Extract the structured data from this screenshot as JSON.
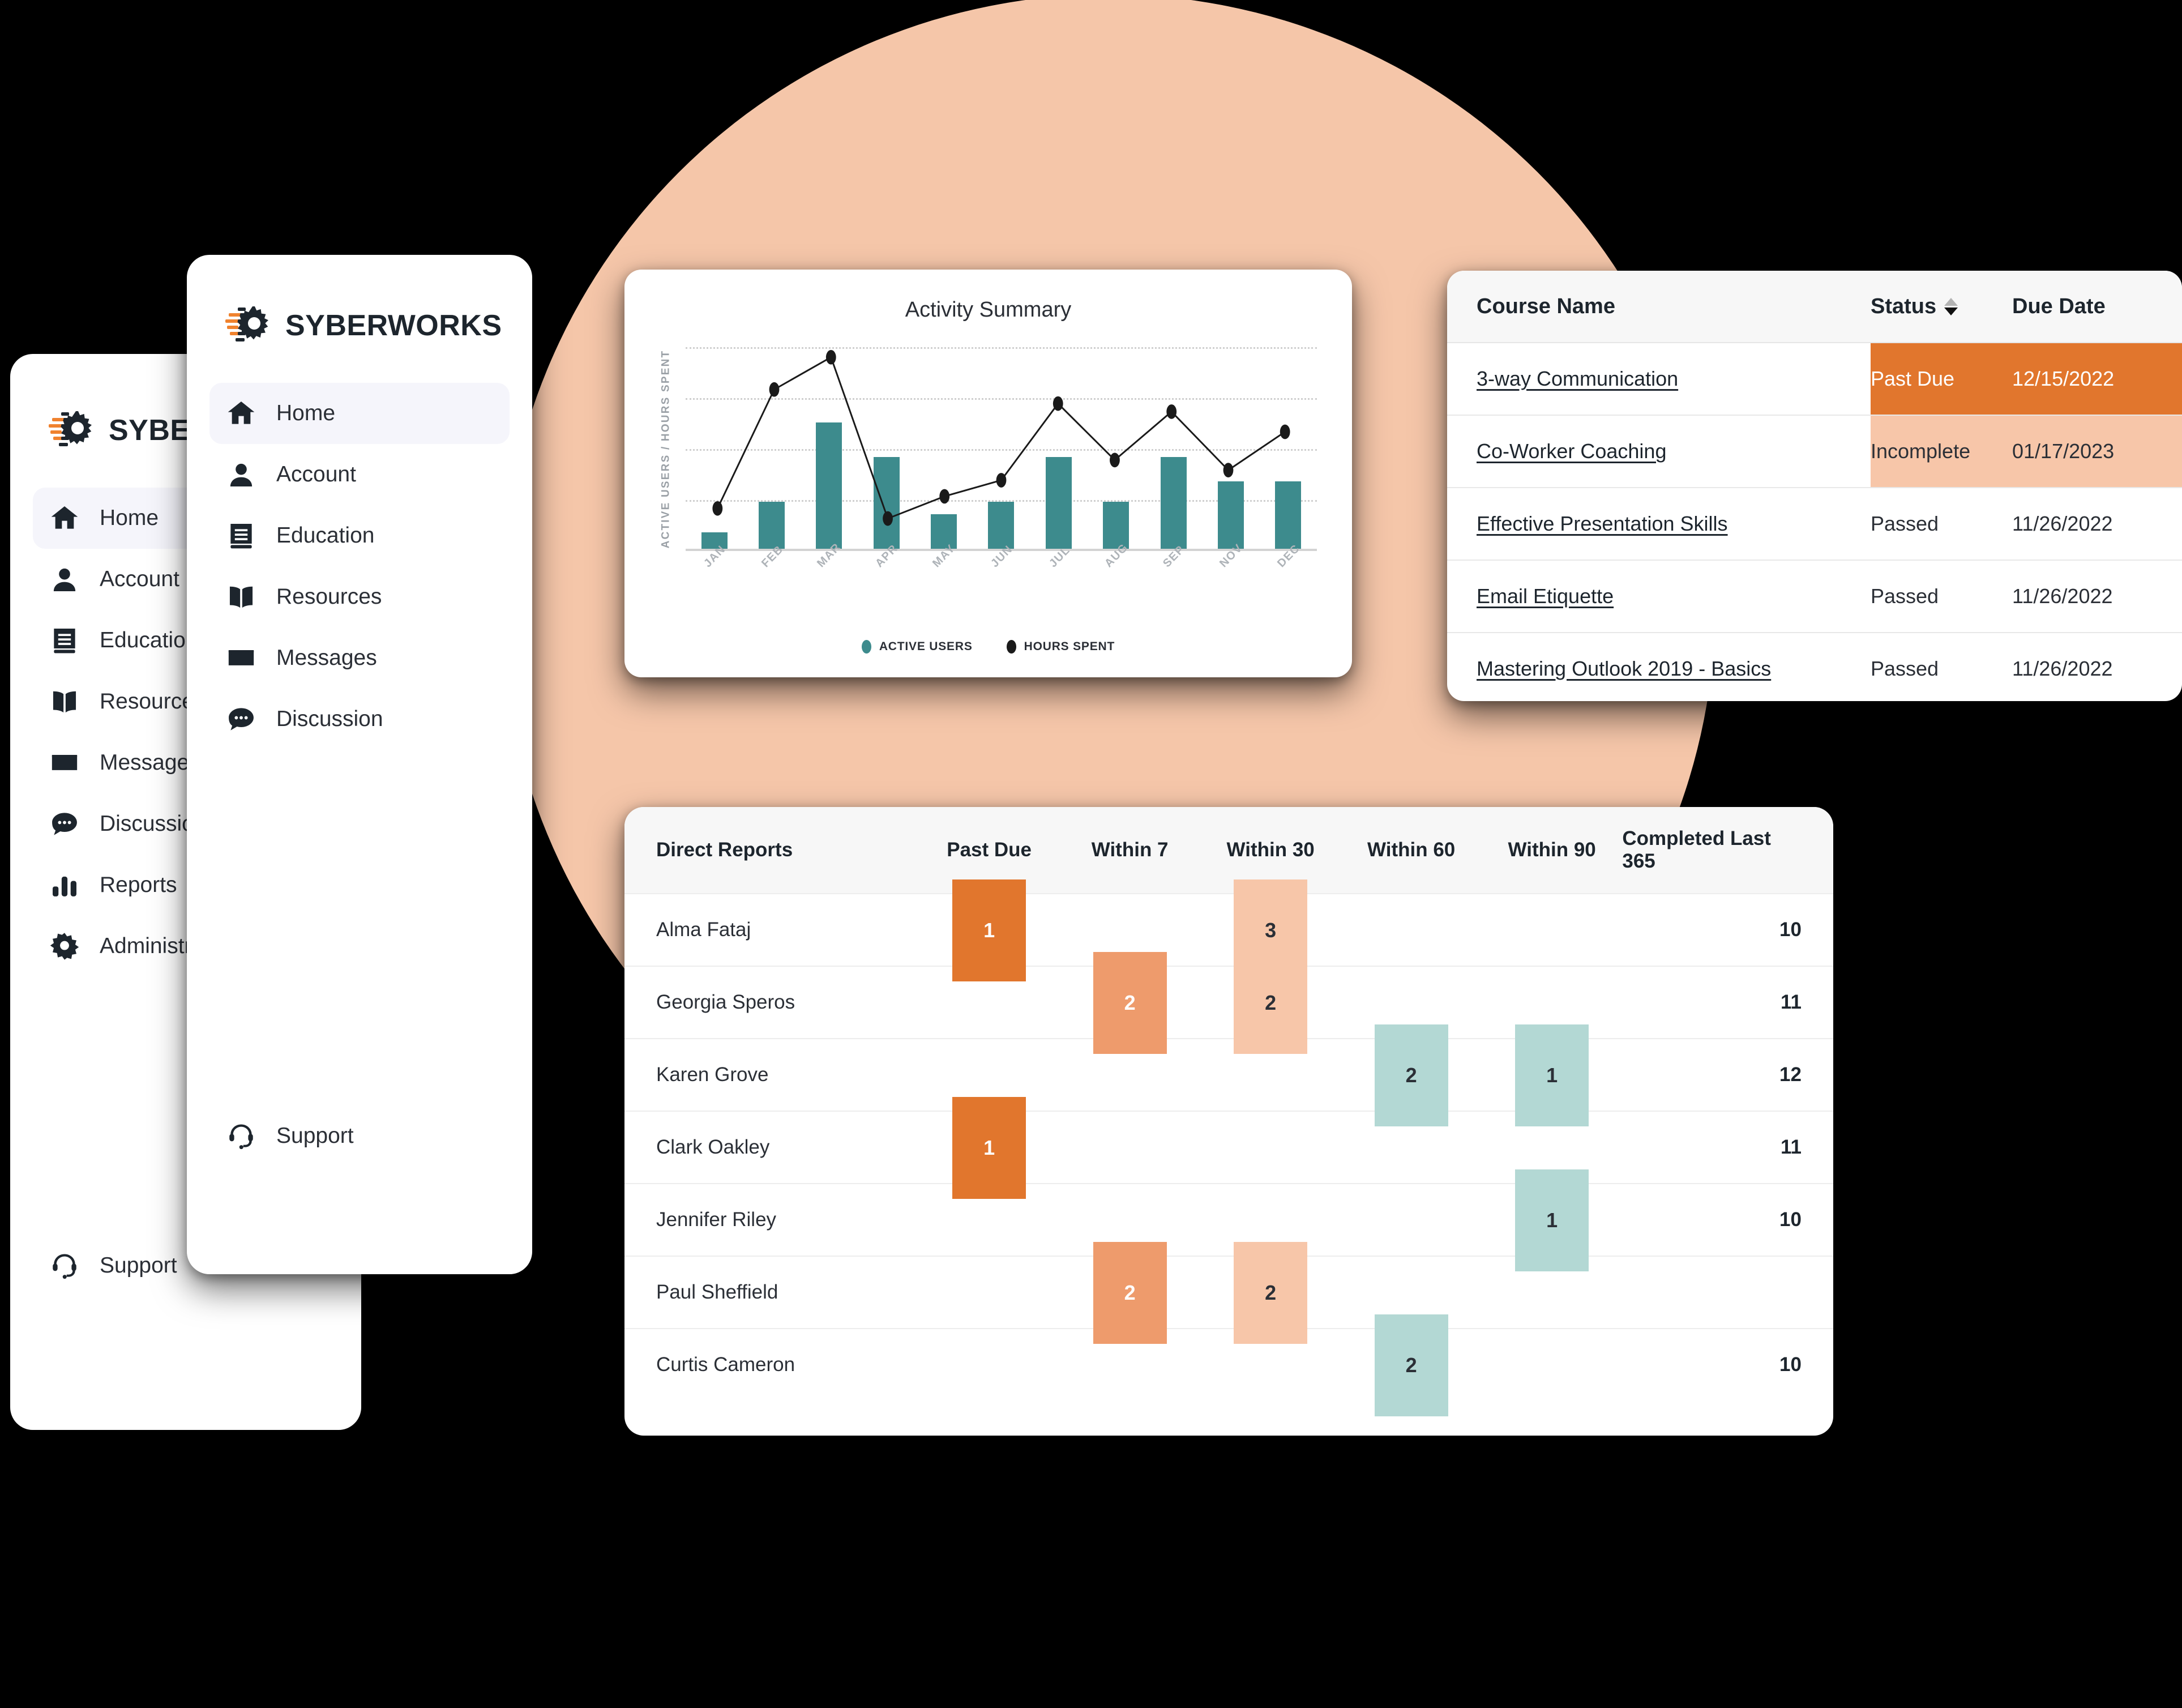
{
  "brand": {
    "name": "SYBERWORKS"
  },
  "sidebar_front": {
    "items": [
      {
        "label": "Home",
        "icon": "home-icon",
        "active": true
      },
      {
        "label": "Account",
        "icon": "user-icon",
        "active": false
      },
      {
        "label": "Education",
        "icon": "book-icon",
        "active": false
      },
      {
        "label": "Resources",
        "icon": "open-book-icon",
        "active": false
      },
      {
        "label": "Messages",
        "icon": "envelope-icon",
        "active": false
      },
      {
        "label": "Discussion",
        "icon": "chat-bubble-icon",
        "active": false
      }
    ],
    "support": {
      "label": "Support",
      "icon": "headset-icon"
    }
  },
  "sidebar_back": {
    "items": [
      {
        "label": "Home",
        "icon": "home-icon",
        "active": true
      },
      {
        "label": "Account",
        "icon": "user-icon",
        "active": false
      },
      {
        "label": "Education",
        "icon": "book-icon",
        "active": false
      },
      {
        "label": "Resources",
        "icon": "open-book-icon",
        "active": false
      },
      {
        "label": "Messages",
        "icon": "envelope-icon",
        "active": false
      },
      {
        "label": "Discussion",
        "icon": "chat-bubble-icon",
        "active": false
      },
      {
        "label": "Reports",
        "icon": "bar-chart-icon",
        "active": false
      },
      {
        "label": "Administration",
        "icon": "gear-icon",
        "active": false
      }
    ],
    "support": {
      "label": "Support",
      "icon": "headset-icon"
    }
  },
  "chart_data": {
    "type": "bar",
    "title": "Activity Summary",
    "xlabel": "",
    "ylabel": "ACTIVE USERS / HOURS SPENT",
    "categories": [
      "JAN",
      "FEB",
      "MAR",
      "APR",
      "MAY",
      "JUN",
      "JUL",
      "AUG",
      "SEP",
      "NOV",
      "DEC"
    ],
    "ylim": [
      0,
      100
    ],
    "grid": true,
    "gridlines": [
      25,
      50,
      75,
      100
    ],
    "legend_position": "bottom",
    "series": [
      {
        "name": "ACTIVE USERS",
        "type": "bar",
        "color": "#3d8b8d",
        "values": [
          8,
          23,
          62,
          45,
          17,
          23,
          45,
          23,
          45,
          33,
          33
        ]
      },
      {
        "name": "HOURS SPENT",
        "type": "line",
        "color": "#1a1a1a",
        "values": [
          20,
          79,
          95,
          15,
          26,
          34,
          72,
          44,
          68,
          39,
          58
        ]
      }
    ]
  },
  "course_table": {
    "columns": [
      "Course Name",
      "Status",
      "Due Date"
    ],
    "sort_column": "Status",
    "rows": [
      {
        "name": "3-way Communication",
        "status": "Past Due",
        "due": "12/15/2022",
        "highlight": "pastdue"
      },
      {
        "name": "Co-Worker Coaching",
        "status": "Incomplete",
        "due": "01/17/2023",
        "highlight": "incomplete"
      },
      {
        "name": "Effective Presentation Skills",
        "status": "Passed",
        "due": "11/26/2022",
        "highlight": "none"
      },
      {
        "name": "Email Etiquette",
        "status": "Passed",
        "due": "11/26/2022",
        "highlight": "none"
      },
      {
        "name": "Mastering Outlook 2019 - Basics",
        "status": "Passed",
        "due": "11/26/2022",
        "highlight": "none"
      }
    ]
  },
  "reports_table": {
    "columns": [
      "Direct Reports",
      "Past Due",
      "Within 7",
      "Within 30",
      "Within 60",
      "Within 90",
      "Completed Last 365"
    ],
    "rows": [
      {
        "name": "Alma Fataj",
        "past_due": "1",
        "within_7": "",
        "within_30": "3",
        "within_60": "",
        "within_90": "",
        "completed": "10"
      },
      {
        "name": "Georgia Speros",
        "past_due": "",
        "within_7": "2",
        "within_30": "2",
        "within_60": "",
        "within_90": "",
        "completed": "11"
      },
      {
        "name": "Karen Grove",
        "past_due": "",
        "within_7": "",
        "within_30": "",
        "within_60": "2",
        "within_90": "1",
        "completed": "12"
      },
      {
        "name": "Clark Oakley",
        "past_due": "1",
        "within_7": "",
        "within_30": "",
        "within_60": "",
        "within_90": "",
        "completed": "11"
      },
      {
        "name": "Jennifer Riley",
        "past_due": "",
        "within_7": "",
        "within_30": "",
        "within_60": "",
        "within_90": "1",
        "completed": "10"
      },
      {
        "name": "Paul Sheffield",
        "past_due": "",
        "within_7": "2",
        "within_30": "2",
        "within_60": "",
        "within_90": "",
        "completed": ""
      },
      {
        "name": "Curtis Cameron",
        "past_due": "",
        "within_7": "",
        "within_30": "",
        "within_60": "2",
        "within_90": "",
        "completed": "10"
      }
    ]
  },
  "colors": {
    "accent_peach": "#f5c6a9",
    "teal": "#3d8b8d",
    "light_teal": "#b3d8d4",
    "orange_past_due": "#e1762d",
    "orange_within7": "#ee9b6c",
    "peach_within30": "#f7c6a9",
    "ink": "#1d252d"
  }
}
